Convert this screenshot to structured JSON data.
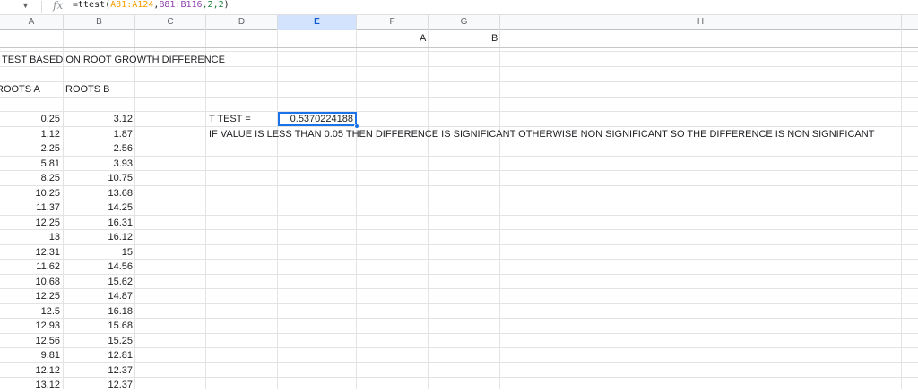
{
  "formula_bar": {
    "fx": "fx",
    "prefix": "=ttest(",
    "range1": "A81:A124",
    "comma1": ",",
    "range2": "B81:B116",
    "suffix_num": ",2,2",
    "close": ")"
  },
  "columns": [
    "A",
    "B",
    "C",
    "D",
    "E",
    "F",
    "G",
    "H"
  ],
  "selected_column": "E",
  "cells": {
    "f_a": "A",
    "g_b": "B",
    "title": "TEST BASED ON ROOT GROWTH DIFFERENCE",
    "roots_a": "ROOTS A",
    "roots_b": "ROOTS B",
    "ttest_label": "T TEST =",
    "ttest_value": "0.5370224188",
    "note": "IF VALUE IS LESS THAN 0.05 THEN  DIFFERENCE IS SIGNIFICANT OTHERWISE NON SIGNIFICANT  SO THE DIFFERENCE IS NON SIGNIFICANT"
  },
  "data_rows": [
    {
      "a": "0.25",
      "b": "3.12"
    },
    {
      "a": "1.12",
      "b": "1.87"
    },
    {
      "a": "2.25",
      "b": "2.56"
    },
    {
      "a": "5.81",
      "b": "3.93"
    },
    {
      "a": "8.25",
      "b": "10.75"
    },
    {
      "a": "10.25",
      "b": "13.68"
    },
    {
      "a": "11.37",
      "b": "14.25"
    },
    {
      "a": "12.25",
      "b": "16.31"
    },
    {
      "a": "13",
      "b": "16.12"
    },
    {
      "a": "12.31",
      "b": "15"
    },
    {
      "a": "11.62",
      "b": "14.56"
    },
    {
      "a": "10.68",
      "b": "15.62"
    },
    {
      "a": "12.25",
      "b": "14.87"
    },
    {
      "a": "12.5",
      "b": "16.18"
    },
    {
      "a": "12.93",
      "b": "15.68"
    },
    {
      "a": "12.56",
      "b": "15.25"
    },
    {
      "a": "9.81",
      "b": "12.81"
    },
    {
      "a": "12.12",
      "b": "12.37"
    },
    {
      "a": "13.12",
      "b": "12.37"
    }
  ]
}
